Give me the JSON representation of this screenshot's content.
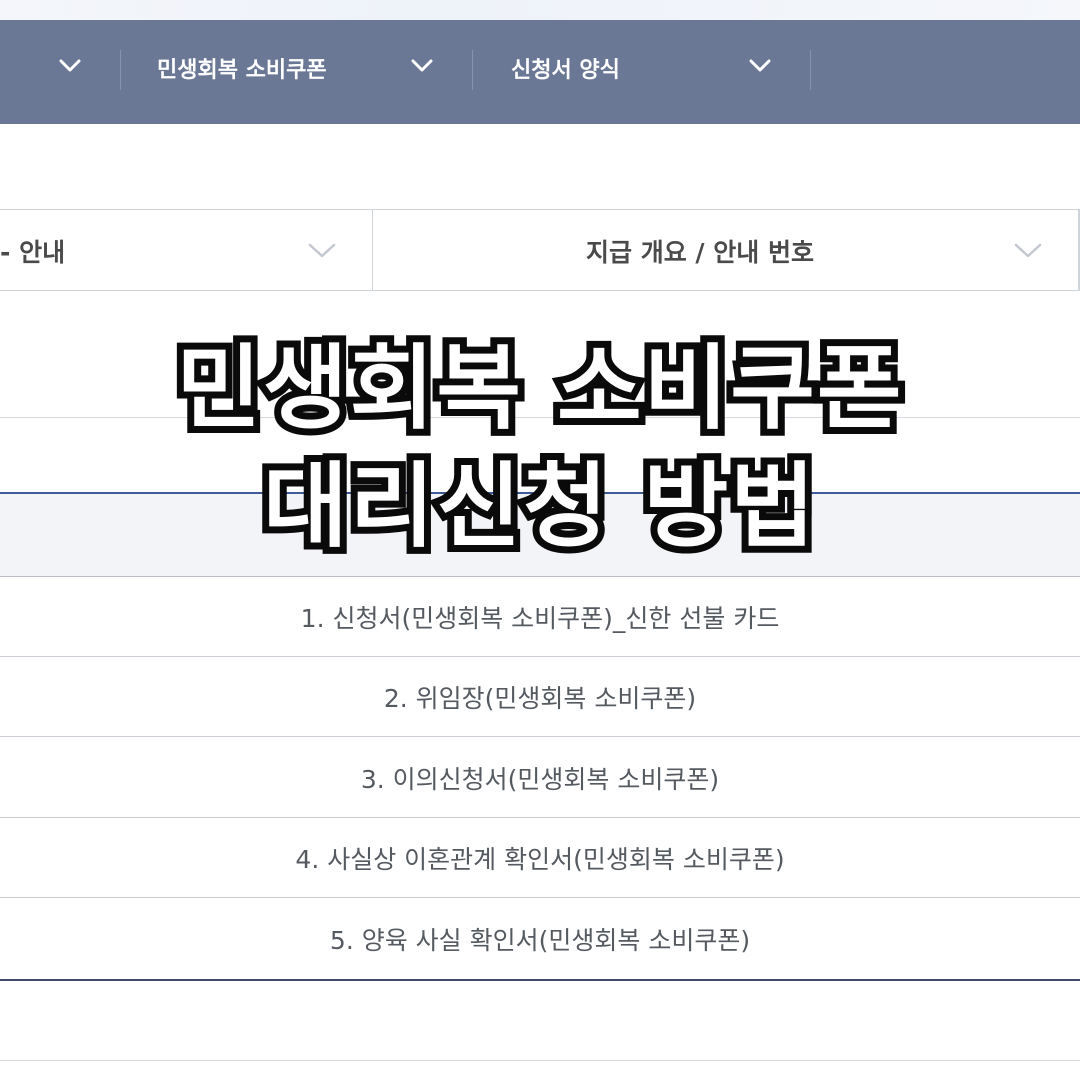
{
  "nav": {
    "items": [
      {
        "label": ""
      },
      {
        "label": "민생회복 소비쿠폰"
      },
      {
        "label": "신청서 양식"
      }
    ]
  },
  "selectors": {
    "left_label": "- 안내",
    "right_label": "지급 개요 / 안내 번호"
  },
  "forms": [
    "1. 신청서(민생회복 소비쿠폰)_신한 선불 카드",
    "2. 위임장(민생회복 소비쿠폰)",
    "3. 이의신청서(민생회복 소비쿠폰)",
    "4. 사실상 이혼관계 확인서(민생회복 소비쿠폰)",
    "5. 양육 사실 확인서(민생회복 소비쿠폰)"
  ],
  "overlay": {
    "line1": "민생회복 소비쿠폰",
    "line2": "대리신청 방법"
  },
  "colors": {
    "navbar": "#6a7795",
    "accent_line": "#3f5b97",
    "text": "#555a60"
  },
  "icons": [
    "chevron-down-icon"
  ]
}
